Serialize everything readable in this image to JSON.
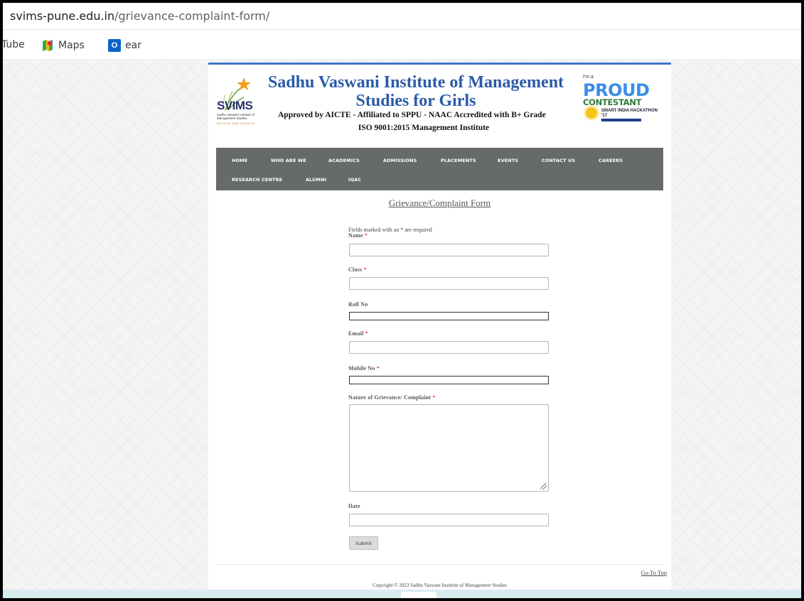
{
  "browser": {
    "url_domain": "svims-pune.edu.in",
    "url_path": "/grievance-complaint-form/",
    "bookmarks": [
      {
        "label": "Tube",
        "icon": "youtube-icon"
      },
      {
        "label": "Maps",
        "icon": "maps-icon"
      },
      {
        "label": "ear",
        "icon": "outlook-icon"
      }
    ]
  },
  "header": {
    "logo_text": "SVIMS",
    "logo_subtext": "Sadhu Vaswani Institute of Management Studies",
    "logo_tagline": "BELIEVE AND ACHIEVE",
    "title": "Sadhu Vaswani Institute of Management Studies for Girls",
    "approval": "Approved by AICTE - Affiliated to SPPU - NAAC Accredited with B+ Grade",
    "iso": "ISO 9001:2015 Management Institute",
    "badge": {
      "im_a": "I'm a",
      "proud": "PROUD",
      "contestant": "CONTESTANT",
      "event": "SMART INDIA HACKATHON '17"
    }
  },
  "nav": {
    "items": [
      "HOME",
      "WHO ARE WE",
      "ACADEMICS",
      "ADMISSIONS",
      "PLACEMENTS",
      "EVENTS",
      "CONTACT US",
      "CAREERS",
      "RESEARCH CENTRE",
      "ALUMNI",
      "IQAC"
    ]
  },
  "form": {
    "title": "Grievance/Complaint Form",
    "required_note": "Fields marked with an * are required",
    "fields": {
      "name": {
        "label": "Name",
        "required": "*",
        "value": ""
      },
      "class": {
        "label": "Class",
        "required": "*",
        "value": ""
      },
      "roll_no": {
        "label": "Roll No",
        "value": ""
      },
      "email": {
        "label": "Email",
        "required": "*",
        "value": ""
      },
      "mobile": {
        "label": "Mobile No",
        "required": "*",
        "value": ""
      },
      "complaint": {
        "label": "Nature of Grievance/ Complaint",
        "required": "*",
        "value": ""
      },
      "date": {
        "label": "Date",
        "value": ""
      }
    },
    "submit_label": "Submit"
  },
  "footer": {
    "go_to_top": "Go To Top",
    "copyright": "Copyright © 2023 Sadhu Vaswani Institute of Management Studies"
  },
  "colors": {
    "title_blue": "#2b5aa8",
    "nav_bg": "#666b69",
    "required_red": "#cc0000",
    "top_border": "#3b76c4"
  }
}
